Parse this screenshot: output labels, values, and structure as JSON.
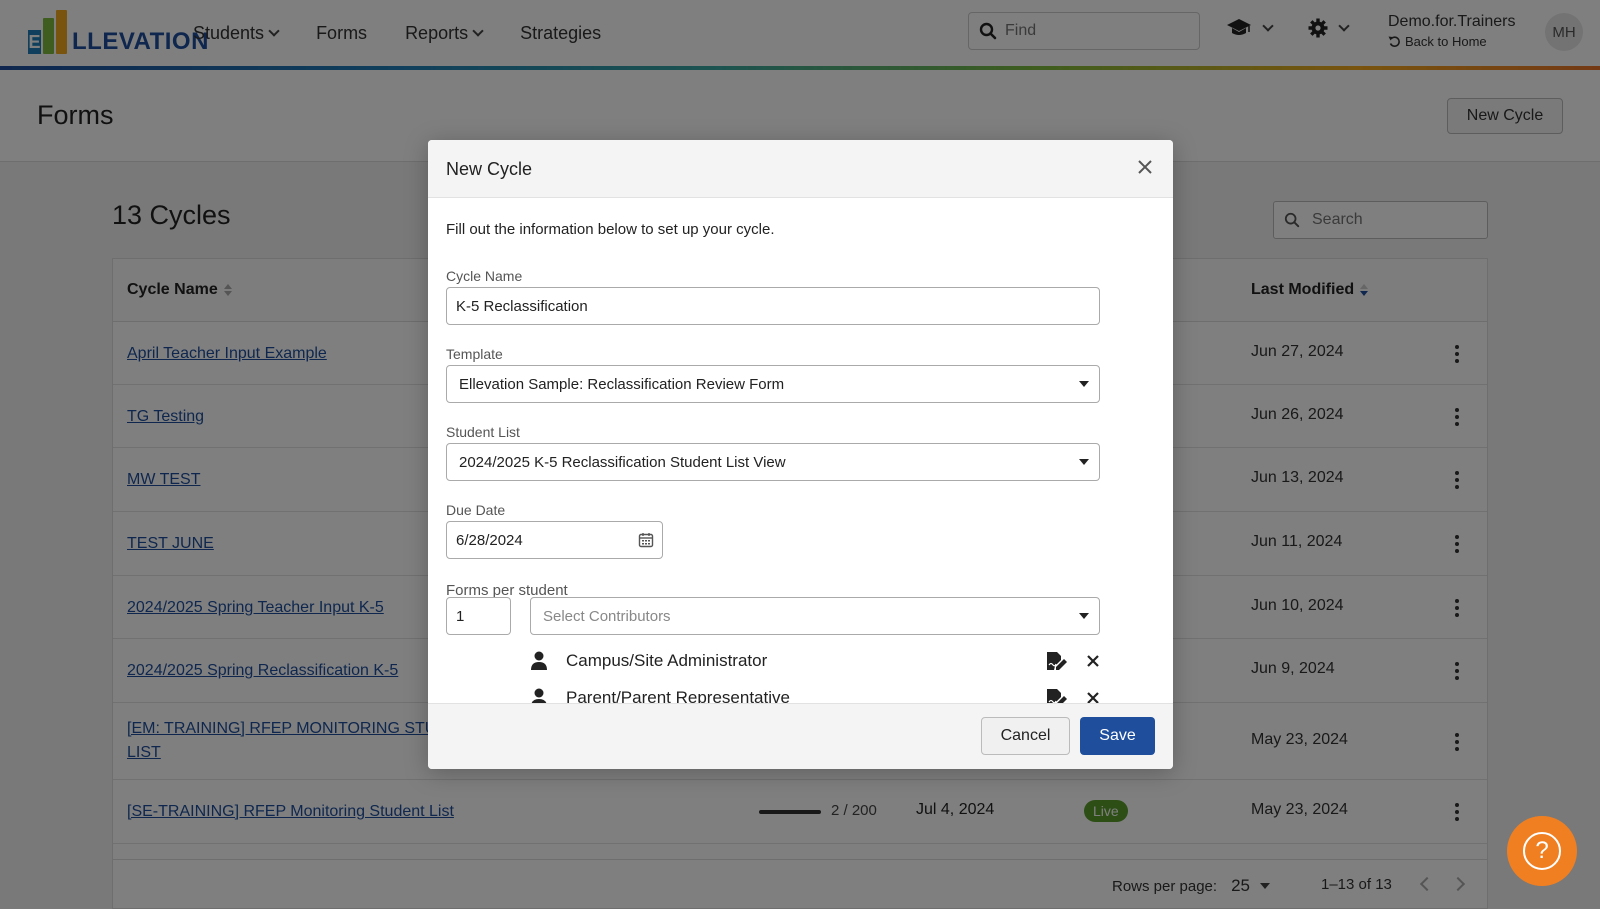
{
  "nav": {
    "logo_text": "LLEVATION",
    "logo_letter": "E",
    "items": [
      {
        "label": "Students",
        "dropdown": true
      },
      {
        "label": "Forms",
        "dropdown": false
      },
      {
        "label": "Reports",
        "dropdown": true
      },
      {
        "label": "Strategies",
        "dropdown": false
      }
    ],
    "find_placeholder": "Find",
    "user_name": "Demo.for.Trainers",
    "back_label": "Back to Home",
    "avatar_initials": "MH"
  },
  "page": {
    "title": "Forms",
    "new_cycle_label": "New Cycle",
    "cycles_count_label": "13 Cycles",
    "search_placeholder": "Search"
  },
  "table": {
    "col_name": "Cycle Name",
    "col_modified": "Last Modified",
    "rows": [
      {
        "name": "April Teacher Input Example",
        "modified": "Jun 27, 2024"
      },
      {
        "name": "TG Testing",
        "modified": "Jun 26, 2024"
      },
      {
        "name": "MW TEST",
        "modified": "Jun 13, 2024"
      },
      {
        "name": "TEST JUNE",
        "modified": "Jun 11, 2024"
      },
      {
        "name": "2024/2025 Spring Teacher Input K-5",
        "modified": "Jun 10, 2024"
      },
      {
        "name": "2024/2025 Spring Reclassification K-5",
        "modified": "Jun 9, 2024"
      },
      {
        "name_line1": "[EM: TRAINING] RFEP MONITORING STUD",
        "name_line2": "LIST",
        "modified": "May 23, 2024"
      },
      {
        "name": "[SE-TRAINING] RFEP Monitoring Student List",
        "progress_label": "2 / 200",
        "due": "Jul 4, 2024",
        "status": "Live",
        "modified": "May 23, 2024"
      }
    ],
    "rows_per_page_label": "Rows per page:",
    "rows_per_page_value": "25",
    "range_label": "1–13 of 13"
  },
  "modal": {
    "title": "New Cycle",
    "intro": "Fill out the information below to set up your cycle.",
    "cycle_name_label": "Cycle Name",
    "cycle_name_value": "K-5 Reclassification",
    "template_label": "Template",
    "template_value": "Ellevation Sample: Reclassification Review Form",
    "student_list_label": "Student List",
    "student_list_value": "2024/2025 K-5 Reclassification Student List View",
    "due_date_label": "Due Date",
    "due_date_value": "6/28/2024",
    "forms_per_student_label": "Forms per student",
    "forms_per_student_value": "1",
    "contributors_placeholder": "Select Contributors",
    "contributors": [
      {
        "name": "Campus/Site Administrator"
      },
      {
        "name": "Parent/Parent Representative"
      }
    ],
    "cancel_label": "Cancel",
    "save_label": "Save"
  },
  "colors": {
    "brand_blue": "#1f4e9c",
    "help_orange": "#f07f22",
    "live_green": "#5a9e2c"
  }
}
